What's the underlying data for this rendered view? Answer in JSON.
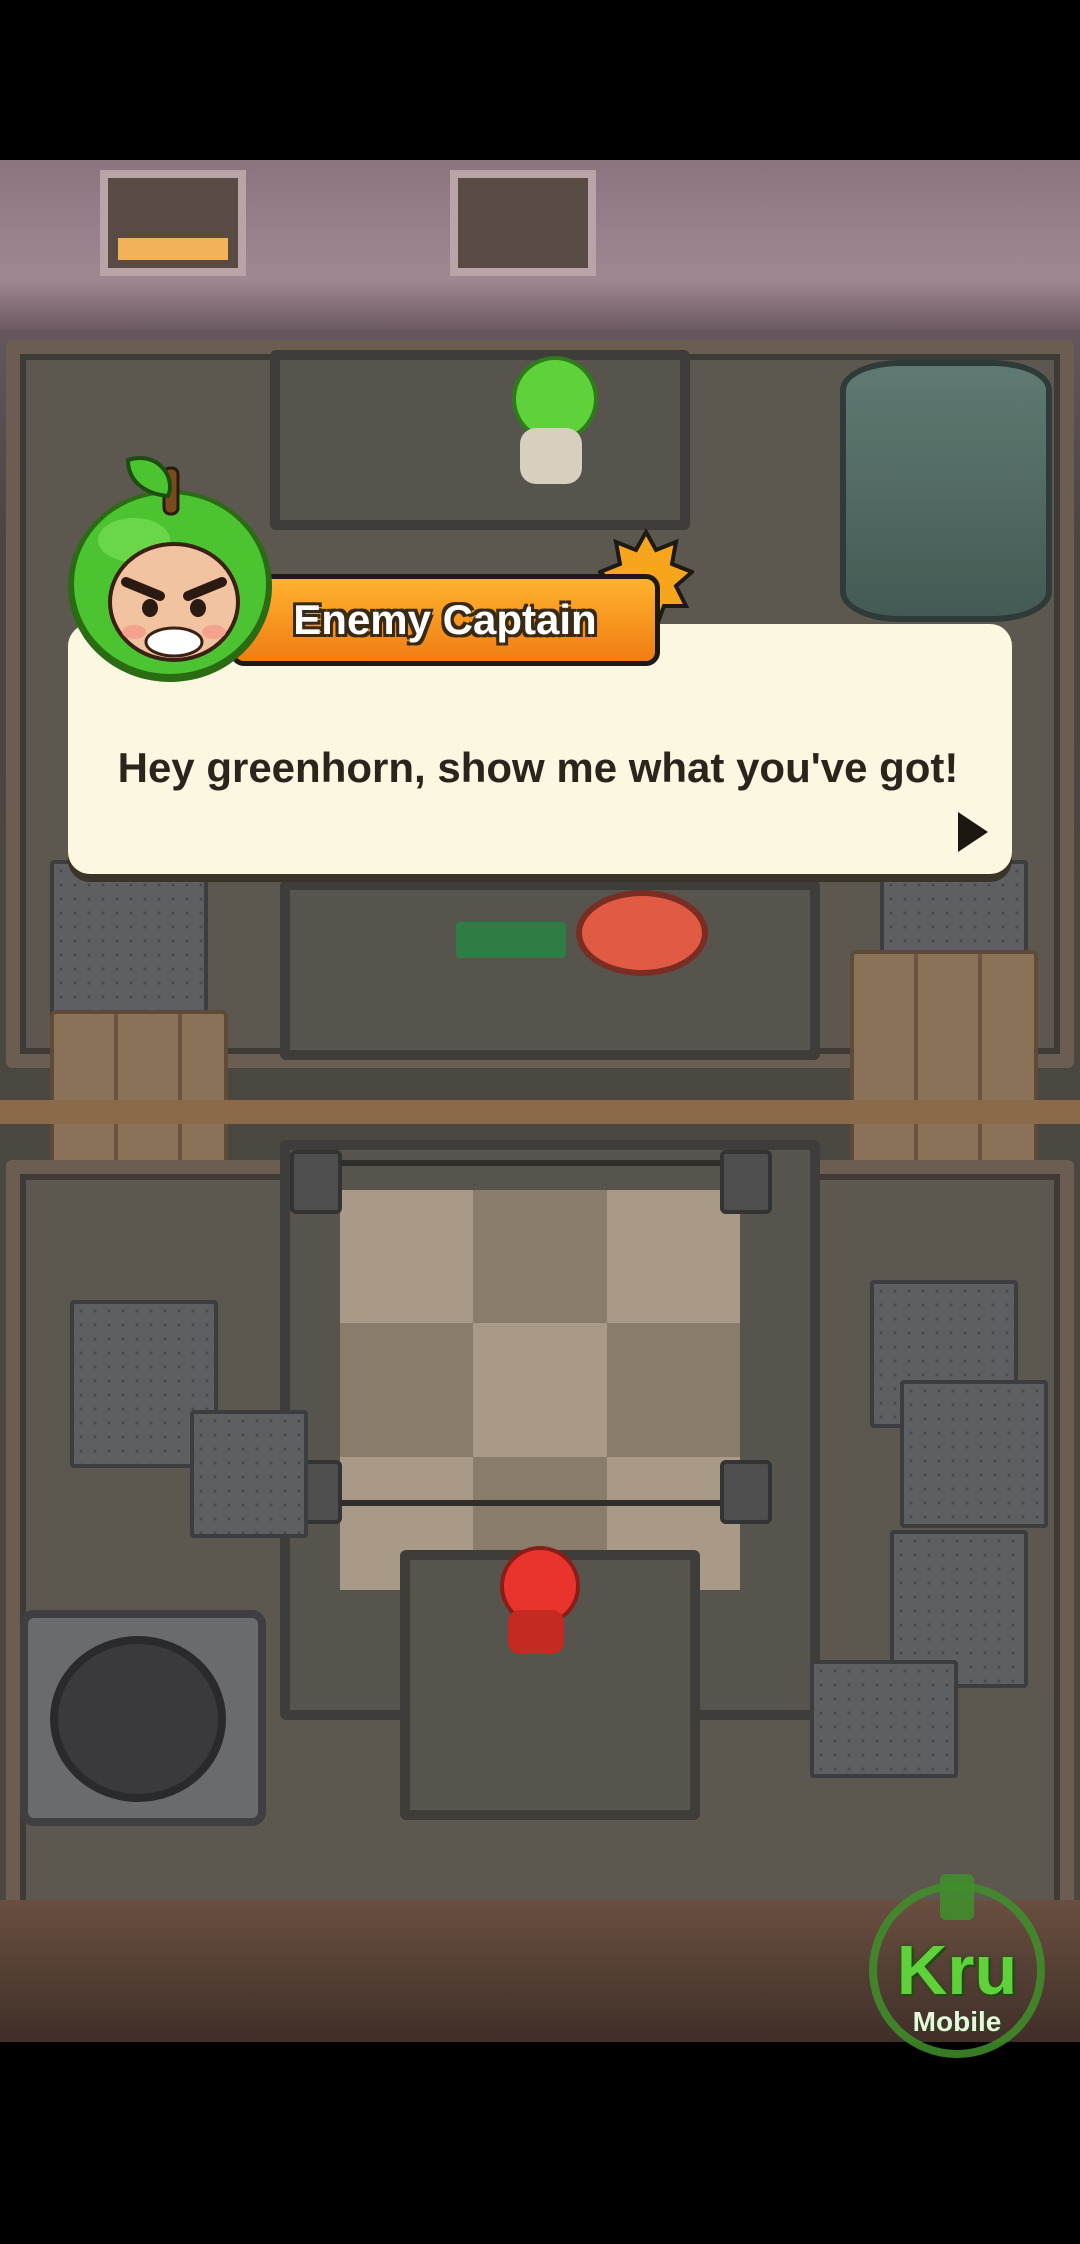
{
  "dialog": {
    "speaker": "Enemy Captain",
    "text": "Hey greenhorn, show me what you've got!",
    "next_icon": "play-arrow-icon"
  },
  "watermark": {
    "line1": "Kru",
    "line2": "Mobile"
  },
  "colors": {
    "dialog_bg": "#fcf7e0",
    "name_tag": "#f07d14",
    "enemy": "#5fd13a",
    "player": "#e8342c"
  }
}
